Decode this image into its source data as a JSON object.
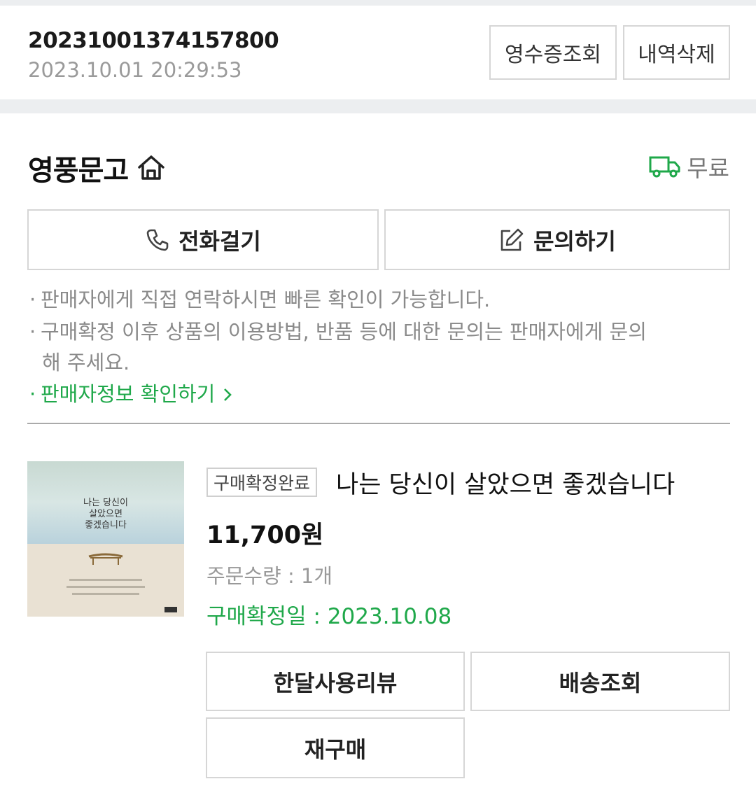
{
  "order": {
    "number": "20231001374157800",
    "datetime": "2023.10.01 20:29:53",
    "receipt_label": "영수증조회",
    "delete_label": "내역삭제"
  },
  "seller": {
    "name": "영풍문고",
    "shipping_fee": "무료",
    "call_label": "전화걸기",
    "inquire_label": "문의하기",
    "notice_1": "판매자에게 직접 연락하시면 빠른 확인이 가능합니다.",
    "notice_2": "구매확정 이후 상품의 이용방법, 반품 등에 대한 문의는 판매자에게 문의",
    "notice_2b": "해 주세요.",
    "seller_info_link": "판매자정보 확인하기"
  },
  "product": {
    "status": "구매확정완료",
    "title": "나는 당신이 살았으면 좋겠습니다",
    "price": "11,700원",
    "quantity": "주문수량 : 1개",
    "confirm_date": "구매확정일 : 2023.10.08",
    "cover": {
      "line1": "나는 당신이",
      "line2": "살았으면",
      "line3": "좋겠습니다"
    }
  },
  "actions": {
    "review_label": "한달사용리뷰",
    "track_label": "배송조회",
    "rebuy_label": "재구매"
  },
  "colors": {
    "accent_green": "#1fa84a",
    "border": "#d6d6d6",
    "muted_text": "#8a8a8a"
  },
  "icons": {
    "home": "home-icon",
    "truck": "truck-icon",
    "phone": "phone-icon",
    "edit": "edit-icon",
    "chevron": "chevron-right-icon"
  }
}
